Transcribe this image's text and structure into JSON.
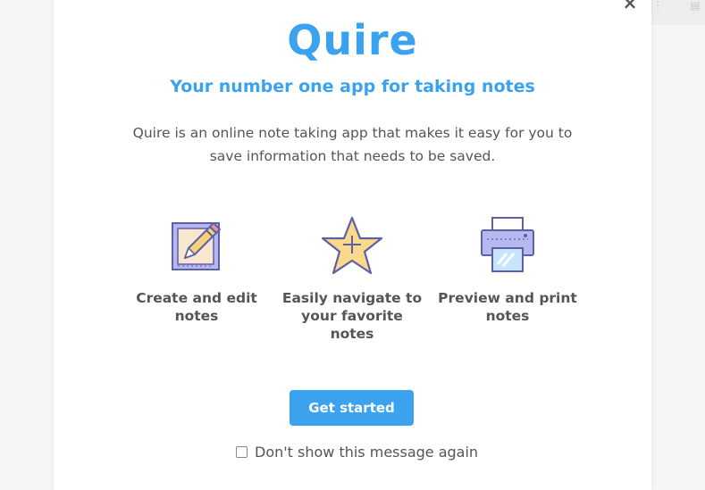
{
  "modal": {
    "logo": "Quire",
    "tagline": "Your number one app for taking notes",
    "description": "Quire is an online note taking app that makes it easy for you to save information that needs to be saved.",
    "features": [
      {
        "label": "Create and edit notes",
        "icon": "edit-note-icon"
      },
      {
        "label": "Easily navigate to your favorite notes",
        "icon": "star-icon"
      },
      {
        "label": "Preview and print notes",
        "icon": "printer-icon"
      }
    ],
    "cta_label": "Get started",
    "dont_show_label": "Don't show this message again",
    "dont_show_checked": false,
    "close_icon": "close-icon"
  },
  "colors": {
    "accent": "#3aa2ee",
    "text": "#555555",
    "background": "#ffffff"
  }
}
